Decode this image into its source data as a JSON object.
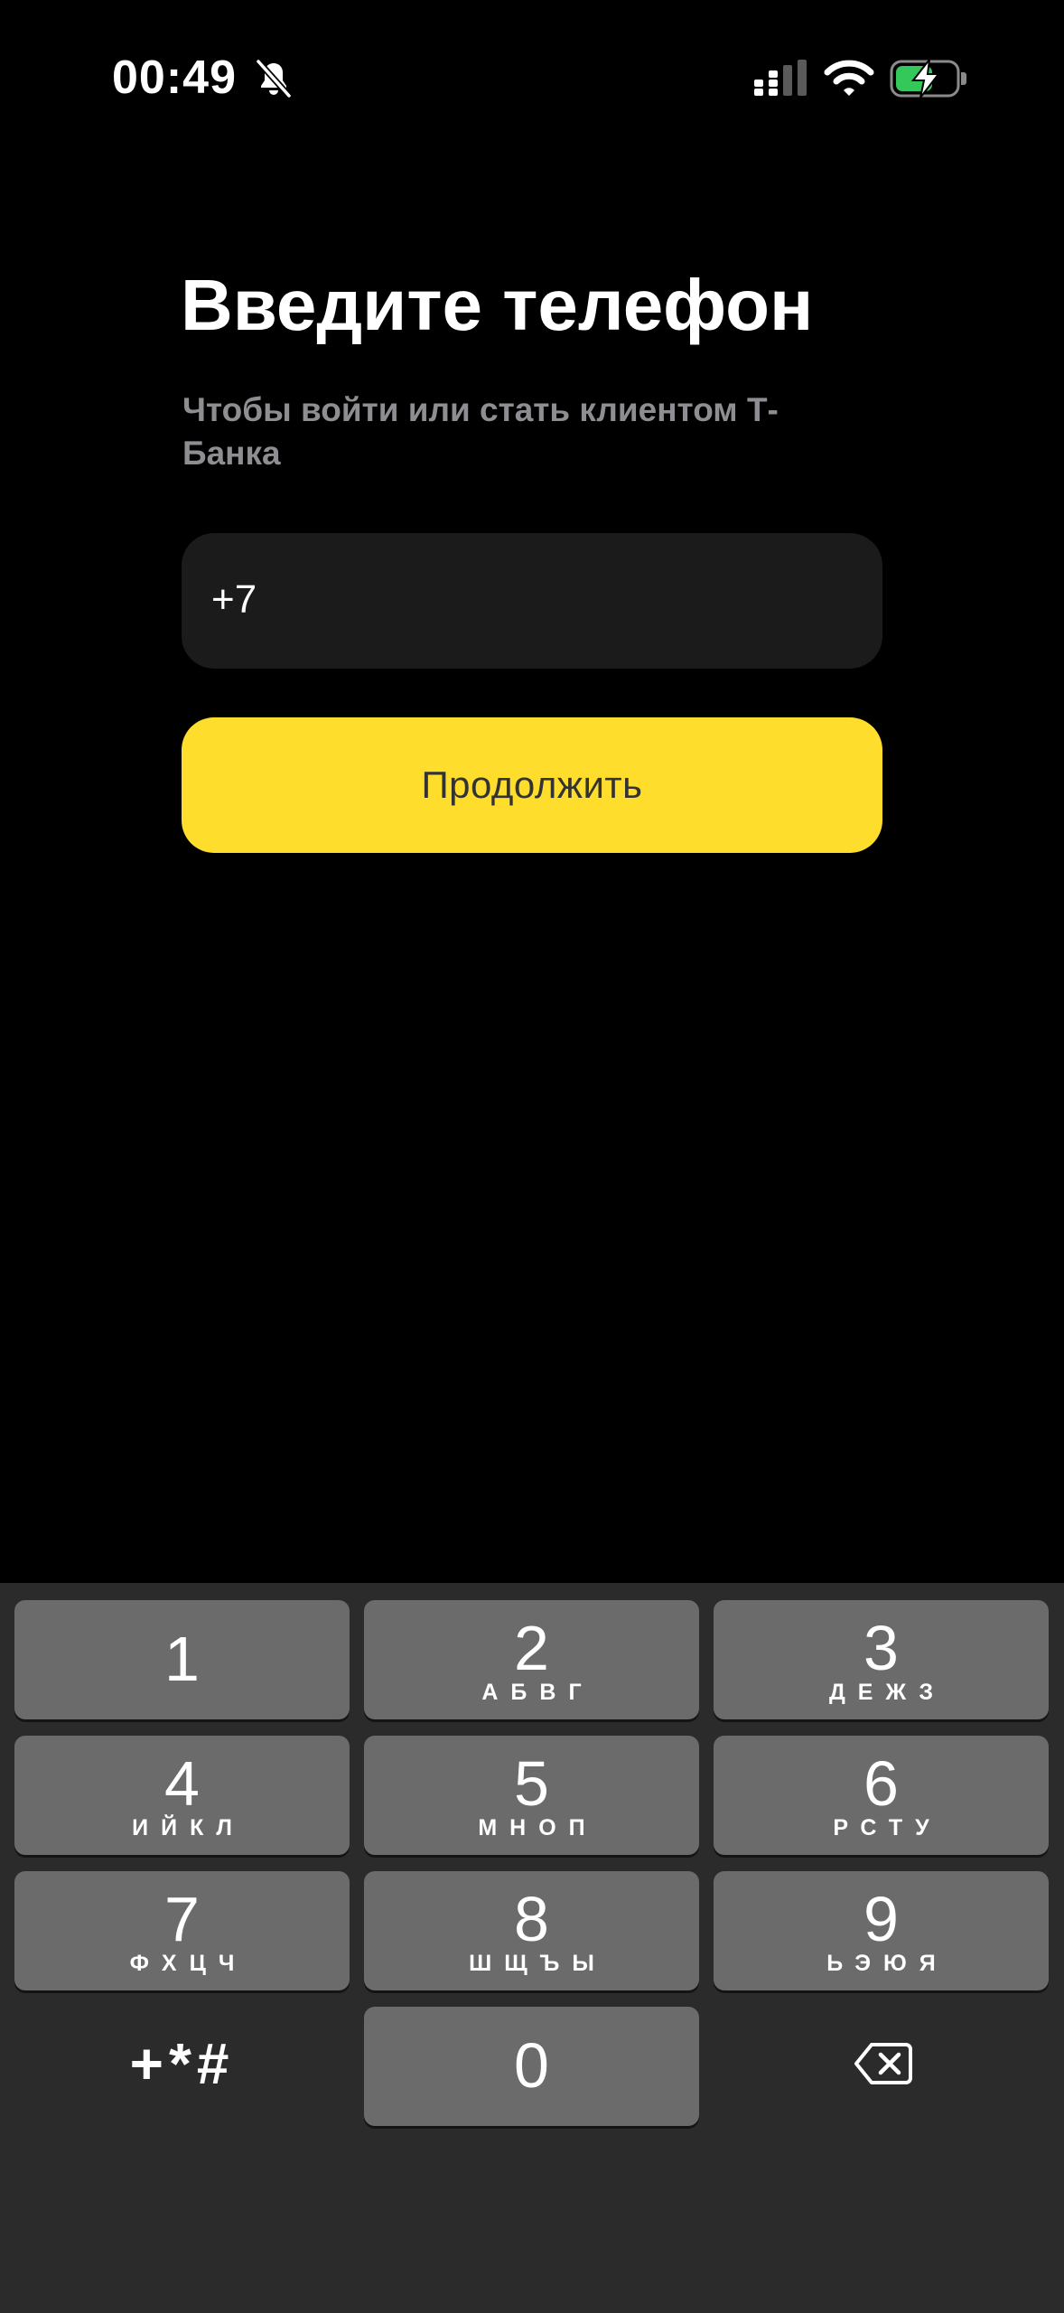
{
  "status_bar": {
    "time": "00:49",
    "icons": [
      "bell-slash-icon",
      "signal-icon",
      "wifi-icon",
      "battery-charging-icon"
    ]
  },
  "colors": {
    "background": "#000000",
    "field_background": "#1b1b1c",
    "accent": "#ffdd2d",
    "subtitle": "#8d8d92",
    "keypad_background": "#2b2b2b",
    "key_background": "#6b6b6b",
    "battery": "#34c759"
  },
  "login": {
    "title": "Введите телефон",
    "subtitle": "Чтобы войти или стать клиентом Т-Банка",
    "phone_value": "+7",
    "continue_label": "Продолжить"
  },
  "keypad": {
    "keys": [
      {
        "digit": "1",
        "letters": ""
      },
      {
        "digit": "2",
        "letters": "АБВГ"
      },
      {
        "digit": "3",
        "letters": "ДЕЖЗ"
      },
      {
        "digit": "4",
        "letters": "ИЙКЛ"
      },
      {
        "digit": "5",
        "letters": "МНОП"
      },
      {
        "digit": "6",
        "letters": "РСТУ"
      },
      {
        "digit": "7",
        "letters": "ФХЦЧ"
      },
      {
        "digit": "8",
        "letters": "ШЩЪЫ"
      },
      {
        "digit": "9",
        "letters": "ЬЭЮЯ"
      },
      {
        "digit": "0",
        "letters": ""
      }
    ],
    "symbols_label": "+*#",
    "backspace_icon": "delete-left-icon"
  }
}
